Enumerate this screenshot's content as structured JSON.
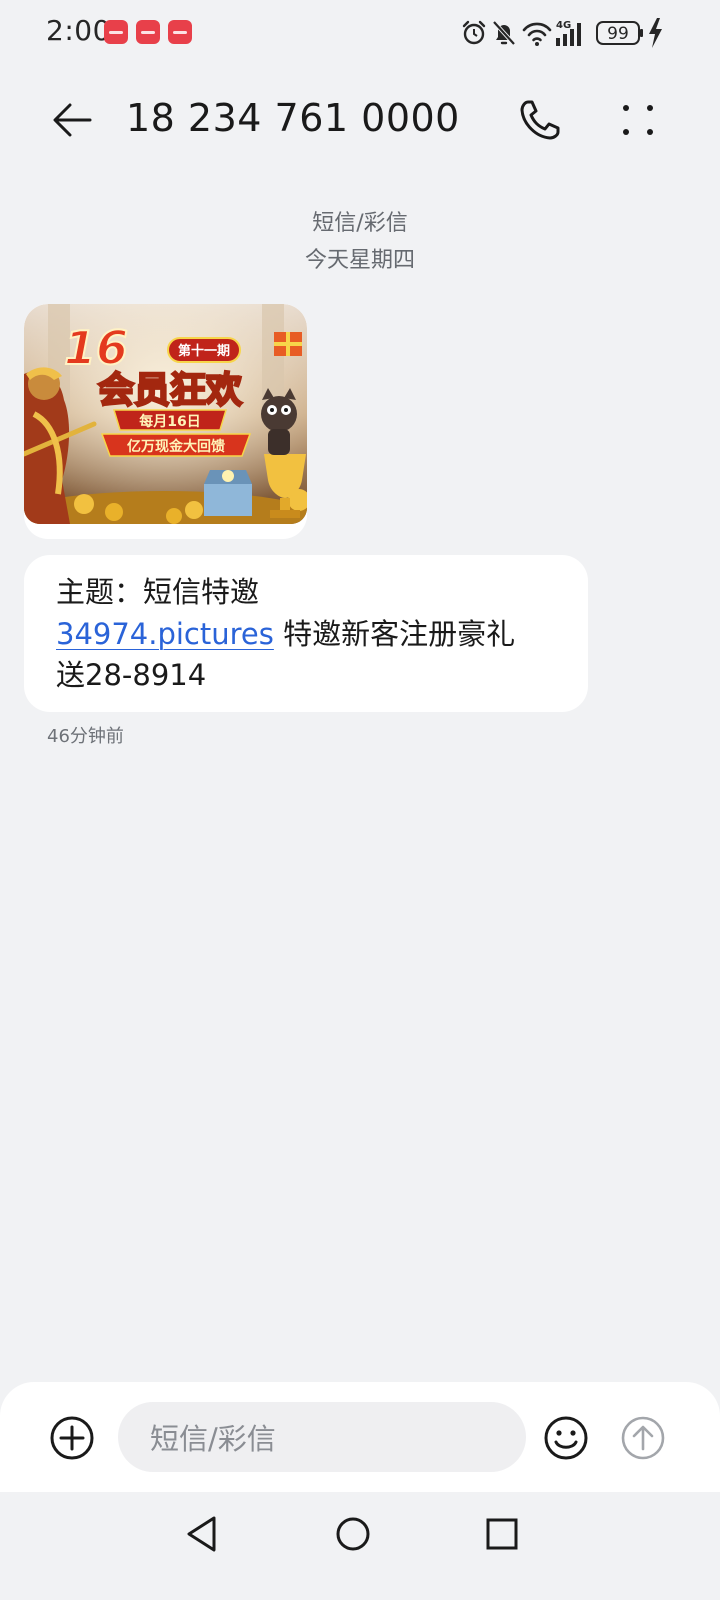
{
  "status_bar": {
    "time": "2:00",
    "battery_level": "99",
    "notification_icons": [
      "app-notification-icon",
      "app-notification-icon",
      "app-notification-icon"
    ],
    "indicator_icons": [
      "alarm-icon",
      "mute-icon",
      "wifi-icon",
      "4g-signal-icon",
      "battery-icon",
      "charging-icon"
    ]
  },
  "header": {
    "contact_number": "18 234 761 0000",
    "back_icon": "back-arrow-icon",
    "call_icon": "phone-icon",
    "more_icon": "more-dots-icon"
  },
  "conversation": {
    "message_type": "短信/彩信",
    "date_label": "今天星期四",
    "mms_image": {
      "headline_number": "16",
      "issue_badge": "第十一期",
      "headline": "会员狂欢",
      "date_ribbon": "每月16日",
      "cash_ribbon": "亿万现金大回馈"
    },
    "message": {
      "subject_line": "主题：短信特邀",
      "link_text": "34974.pictures",
      "text_after_link": " 特邀新客注册豪礼",
      "last_line": "送28-8914"
    },
    "timestamp": "46分钟前"
  },
  "input_bar": {
    "placeholder": "短信/彩信",
    "add_icon": "add-circle-icon",
    "emoji_icon": "emoji-icon",
    "send_icon": "send-arrow-icon"
  },
  "nav_bar": {
    "back_icon": "nav-back-icon",
    "home_icon": "nav-home-icon",
    "recents_icon": "nav-recents-icon"
  },
  "colors": {
    "background": "#f1f2f4",
    "bubble": "#ffffff",
    "link": "#2a63d8",
    "notification_badge": "#e8404a",
    "secondary_text": "#666a70"
  }
}
